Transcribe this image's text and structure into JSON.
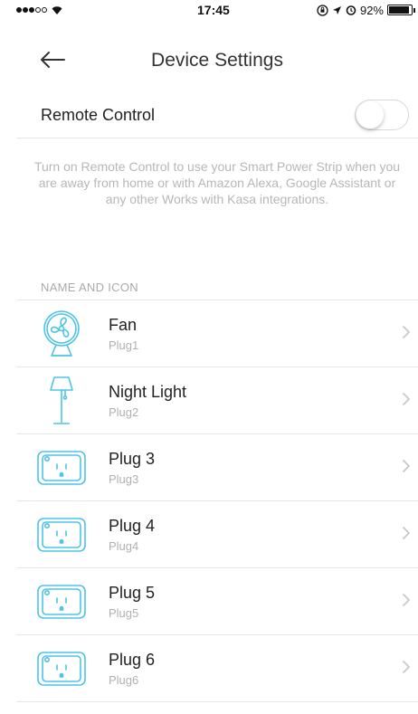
{
  "status": {
    "time": "17:45",
    "battery": "92%"
  },
  "header": {
    "title": "Device Settings"
  },
  "remote": {
    "label": "Remote Control",
    "enabled": false,
    "description": "Turn on Remote Control to use your Smart Power Strip when you are away from home or with Amazon Alexa, Google Assistant or any other Works with Kasa integrations."
  },
  "section": {
    "label": "NAME AND ICON"
  },
  "devices": [
    {
      "name": "Fan",
      "plug": "Plug1",
      "icon": "fan-icon"
    },
    {
      "name": "Night Light",
      "plug": "Plug2",
      "icon": "lamp-icon"
    },
    {
      "name": "Plug 3",
      "plug": "Plug3",
      "icon": "outlet-icon"
    },
    {
      "name": "Plug 4",
      "plug": "Plug4",
      "icon": "outlet-icon"
    },
    {
      "name": "Plug 5",
      "plug": "Plug5",
      "icon": "outlet-icon"
    },
    {
      "name": "Plug 6",
      "plug": "Plug6",
      "icon": "outlet-icon"
    }
  ],
  "colors": {
    "icon_accent": "#4dc4e8",
    "chevron": "#c7c7cc"
  }
}
